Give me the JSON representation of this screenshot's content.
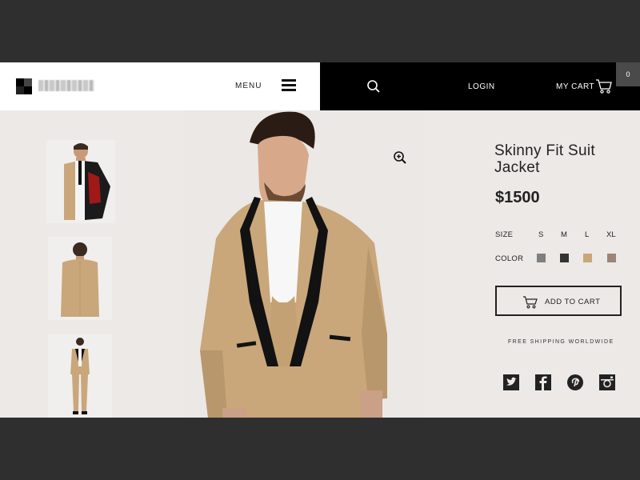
{
  "header": {
    "menu_label": "MENU",
    "login_label": "LOGIN",
    "cart_label": "MY CART",
    "cart_count": "0"
  },
  "product": {
    "title": "Skinny Fit Suit Jacket",
    "price": "$1500",
    "size_label": "SIZE",
    "sizes": [
      "S",
      "M",
      "L",
      "XL"
    ],
    "color_label": "COLOR",
    "colors": [
      "#7f7f7f",
      "#333333",
      "#c9a77a",
      "#9c8478"
    ],
    "add_to_cart_label": "ADD TO CART",
    "shipping_note": "FREE SHIPPING WORLDWIDE"
  },
  "icons": {
    "search": "search-icon",
    "menu": "hamburger-icon",
    "cart": "cart-icon",
    "zoom": "zoom-in-icon",
    "social": [
      "twitter-icon",
      "facebook-icon",
      "pinterest-icon",
      "instagram-icon"
    ]
  },
  "colors": {
    "background_outer": "#2f2f2f",
    "content_bg": "#ece9e7",
    "header_dark": "#000000",
    "suit": "#c9a77a",
    "lapel": "#111111"
  }
}
